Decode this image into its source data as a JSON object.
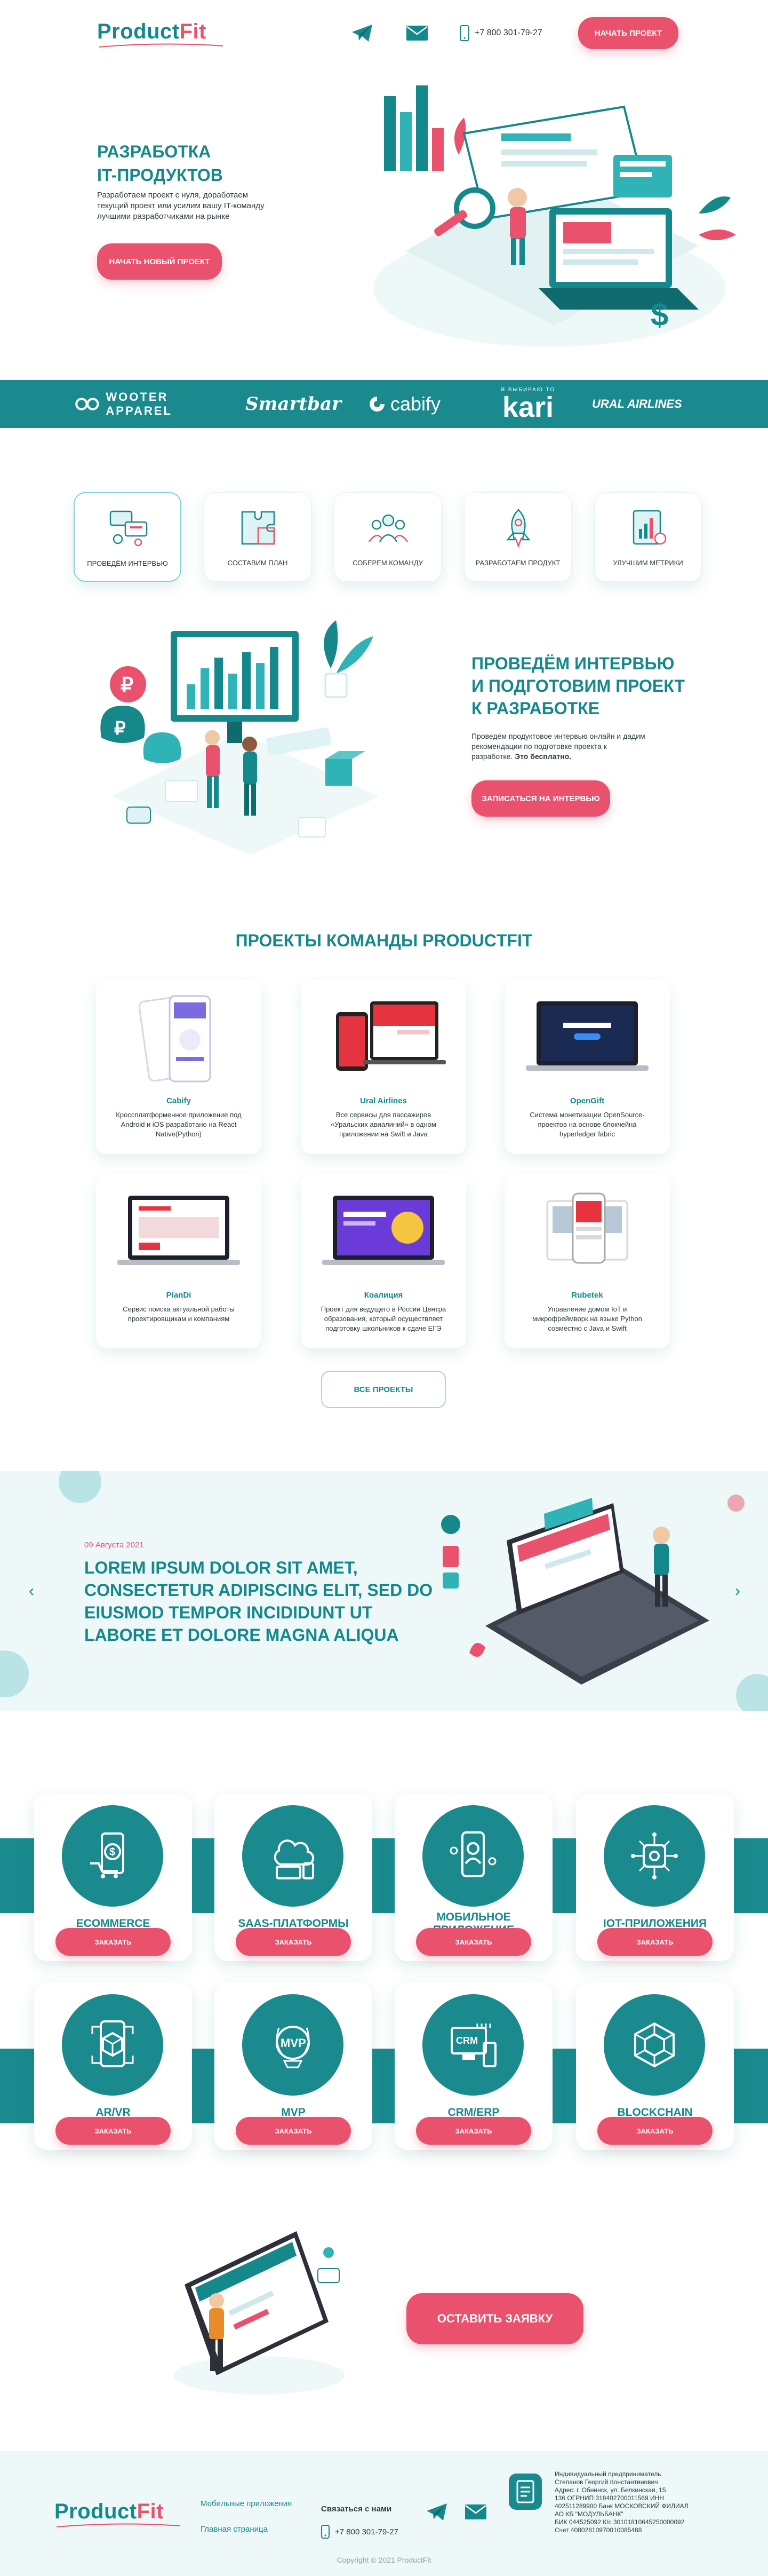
{
  "colors": {
    "teal": "#14888b",
    "band": "#1a8a8e",
    "pink": "#e9516d",
    "light": "#eef8f9"
  },
  "header": {
    "logo_main": "Product",
    "logo_accent": "Fit",
    "telegram_icon": "telegram-icon",
    "mail_icon": "mail-icon",
    "phone_icon": "phone-icon",
    "phone": "+7 800 301-79-27",
    "cta": "Начать проект"
  },
  "hero": {
    "title": [
      "Разработка",
      "IT-продуктов"
    ],
    "description": "Разработаем проект с нуля, доработаем текущий проект или усилим вашу IT-команду лучшими разработчиками на рынке",
    "cta": "Начать новый проект"
  },
  "partners": [
    "WOOTER APPAREL",
    "Smartbar",
    "cabify",
    "kari",
    "URAL AIRLINES"
  ],
  "partners_kari_tag": "Я ВЫБИРАЮ ТО",
  "steps": [
    {
      "label": "Проведём интервью",
      "icon": "interview-icon",
      "active": true
    },
    {
      "label": "Составим план",
      "icon": "puzzle-icon"
    },
    {
      "label": "Соберем команду",
      "icon": "team-icon"
    },
    {
      "label": "Разработаем продукт",
      "icon": "rocket-icon"
    },
    {
      "label": "Улучшим метрики",
      "icon": "metrics-icon"
    }
  ],
  "interview": {
    "title": [
      "Проведём интервью",
      "и подготовим проект",
      "к разработке"
    ],
    "description": "Проведём продуктовое интервью онлайн и дадим рекомендации по подготовке проекта к разработке.",
    "description_bold": "Это бесплатно.",
    "cta": "Записаться на интервью"
  },
  "projects": {
    "title": "Проекты команды ProductFit",
    "items": [
      {
        "name": "Cabify",
        "description": "Кроссплатформенное приложение под Android и iOS разработано на React Native(Python)"
      },
      {
        "name": "Ural Airlines",
        "description": "Все сервисы для пассажиров «Уральских авиалиний» в одном приложении на Swift и Java"
      },
      {
        "name": "OpenGift",
        "description": "Система монетизации OpenSource-проектов на основе блокчейна hyperledger fabric"
      },
      {
        "name": "PlanDi",
        "description": "Сервис поиска актуальной работы проектировщикам и компаниям"
      },
      {
        "name": "Коалиция",
        "description": "Проект для ведущего в России Центра образования, который осуществляет подготовку школьников к сдаче ЕГЭ"
      },
      {
        "name": "Rubetek",
        "description": "Управление домом IoT и микрофреймворк на языке Python совместно с Java и Swift"
      }
    ],
    "all_button": "Все проекты"
  },
  "blog": {
    "date": "09 Августа 2021",
    "title": [
      "Lorem ipsum dolor sit amet,",
      "consectetur adipiscing elit, sed do",
      "eiusmod tempor incididunt ut",
      "labore et dolore magna aliqua"
    ],
    "prev": "‹",
    "next": "›"
  },
  "services": {
    "order_label": "Заказать",
    "items": [
      {
        "name": "Ecommerce",
        "icon": "ecommerce-icon"
      },
      {
        "name": "SaaS-платформы",
        "icon": "saas-icon"
      },
      {
        "name": "Мобильное приложение",
        "icon": "mobile-app-icon"
      },
      {
        "name": "IoT-приложения",
        "icon": "iot-icon"
      },
      {
        "name": "AR/VR",
        "icon": "ar-vr-icon"
      },
      {
        "name": "MVP",
        "icon": "mvp-icon"
      },
      {
        "name": "CRM/ERP",
        "icon": "crm-icon"
      },
      {
        "name": "Blockchain",
        "icon": "blockchain-icon"
      }
    ]
  },
  "request": {
    "cta": "Оставить заявку"
  },
  "footer": {
    "links": [
      "Мобильные приложения",
      "Главная страница"
    ],
    "contact_title": "Связаться с нами",
    "phone": "+7 800 301-79-27",
    "requisites": [
      "Индивидуальный предприниматель",
      "Степанов Георгий Константинович",
      "Адрес: г. Обнинск, ул. Белкинская, 15",
      "136 ОГРНИП 318402700011569 ИНН",
      "402511289900 Банк МОСКОВСКИЙ ФИЛИАЛ",
      "АО КБ \"МОДУЛЬБАНК\"",
      "БИК 044525092 К/с 30101810645250000092",
      "Счет 40802810970010085488"
    ],
    "copyright": "Copyright © 2021 ProductFit"
  }
}
